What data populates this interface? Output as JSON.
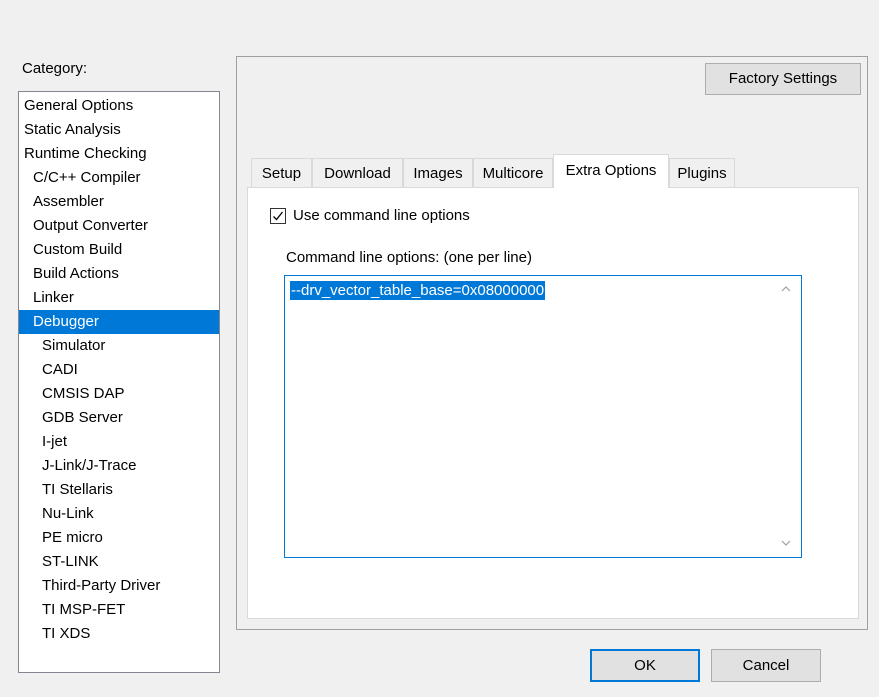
{
  "category": {
    "label": "Category:",
    "items": [
      {
        "label": "General Options",
        "level": 0
      },
      {
        "label": "Static Analysis",
        "level": 0
      },
      {
        "label": "Runtime Checking",
        "level": 0
      },
      {
        "label": "C/C++ Compiler",
        "level": 1
      },
      {
        "label": "Assembler",
        "level": 1
      },
      {
        "label": "Output Converter",
        "level": 1
      },
      {
        "label": "Custom Build",
        "level": 1
      },
      {
        "label": "Build Actions",
        "level": 1
      },
      {
        "label": "Linker",
        "level": 1
      },
      {
        "label": "Debugger",
        "level": 1,
        "selected": true
      },
      {
        "label": "Simulator",
        "level": 2
      },
      {
        "label": "CADI",
        "level": 2
      },
      {
        "label": "CMSIS DAP",
        "level": 2
      },
      {
        "label": "GDB Server",
        "level": 2
      },
      {
        "label": "I-jet",
        "level": 2
      },
      {
        "label": "J-Link/J-Trace",
        "level": 2
      },
      {
        "label": "TI Stellaris",
        "level": 2
      },
      {
        "label": "Nu-Link",
        "level": 2
      },
      {
        "label": "PE micro",
        "level": 2
      },
      {
        "label": "ST-LINK",
        "level": 2
      },
      {
        "label": "Third-Party Driver",
        "level": 2
      },
      {
        "label": "TI MSP-FET",
        "level": 2
      },
      {
        "label": "TI XDS",
        "level": 2
      }
    ]
  },
  "factory_settings_label": "Factory Settings",
  "tabs": [
    "Setup",
    "Download",
    "Images",
    "Multicore",
    "Extra Options",
    "Plugins"
  ],
  "active_tab": "Extra Options",
  "extra_options": {
    "use_cmd_label": "Use command line options",
    "use_cmd_checked": true,
    "cmd_label": "Command line options:  (one per line)",
    "cmd_value": "--drv_vector_table_base=0x08000000"
  },
  "buttons": {
    "ok": "OK",
    "cancel": "Cancel"
  },
  "colors": {
    "selection": "#0078d7",
    "dialog_bg": "#f0f0f0"
  }
}
